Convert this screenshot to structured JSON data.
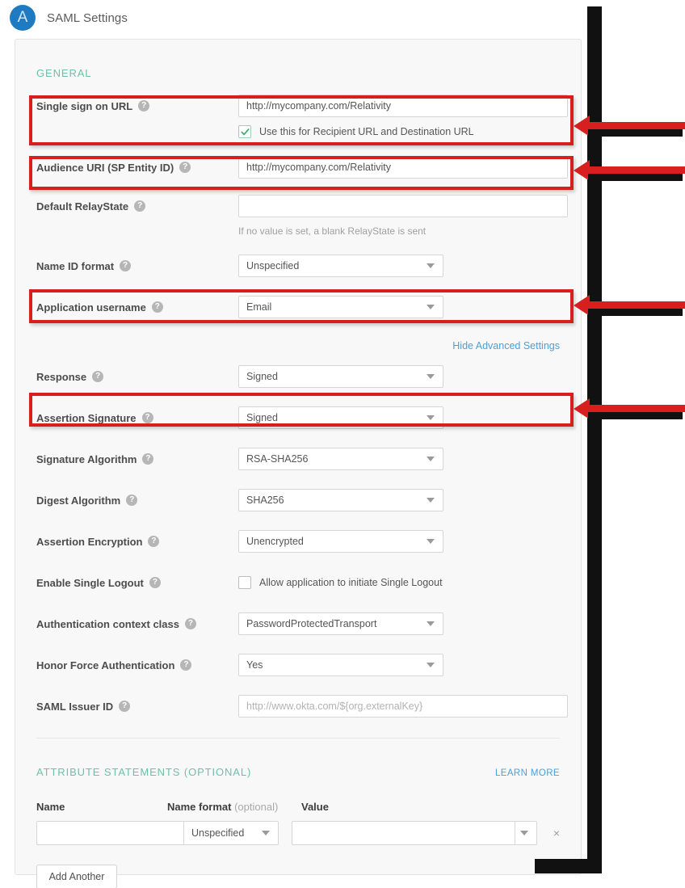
{
  "header": {
    "avatar_letter": "A",
    "title": "SAML Settings"
  },
  "general": {
    "section_label": "GENERAL",
    "fields": {
      "single_sign_on_url": {
        "label": "Single sign on URL",
        "value": "http://mycompany.com/Relativity",
        "checkbox_label": "Use this for Recipient URL and Destination URL",
        "checkbox_checked": true
      },
      "audience_uri": {
        "label": "Audience URI (SP Entity ID)",
        "value": "http://mycompany.com/Relativity"
      },
      "default_relaystate": {
        "label": "Default RelayState",
        "value": "",
        "hint": "If no value is set, a blank RelayState is sent"
      },
      "name_id_format": {
        "label": "Name ID format",
        "value": "Unspecified"
      },
      "application_username": {
        "label": "Application username",
        "value": "Email"
      }
    },
    "advanced_toggle": "Hide Advanced Settings",
    "advanced": {
      "response": {
        "label": "Response",
        "value": "Signed"
      },
      "assertion_signature": {
        "label": "Assertion Signature",
        "value": "Signed"
      },
      "signature_algorithm": {
        "label": "Signature Algorithm",
        "value": "RSA-SHA256"
      },
      "digest_algorithm": {
        "label": "Digest Algorithm",
        "value": "SHA256"
      },
      "assertion_encryption": {
        "label": "Assertion Encryption",
        "value": "Unencrypted"
      },
      "enable_single_logout": {
        "label": "Enable Single Logout",
        "checkbox_label": "Allow application to initiate Single Logout",
        "checkbox_checked": false
      },
      "authentication_context_class": {
        "label": "Authentication context class",
        "value": "PasswordProtectedTransport"
      },
      "honor_force_authentication": {
        "label": "Honor Force Authentication",
        "value": "Yes"
      },
      "saml_issuer_id": {
        "label": "SAML Issuer ID",
        "value": "",
        "placeholder": "http://www.okta.com/${org.externalKey}"
      }
    }
  },
  "attributes": {
    "section_label": "ATTRIBUTE STATEMENTS (OPTIONAL)",
    "learn_more": "LEARN MORE",
    "columns": {
      "name": "Name",
      "name_format": "Name format",
      "name_format_optional": "(optional)",
      "value": "Value"
    },
    "rows": [
      {
        "name": "",
        "name_format": "Unspecified",
        "value": "",
        "remove_icon": "×"
      }
    ],
    "add_another": "Add Another"
  },
  "icons": {
    "help": "?",
    "caret_down": "caret-down",
    "check": "check-mark",
    "close": "×"
  },
  "colors": {
    "accent_blue": "#1f7bc1",
    "link_blue": "#4c9fd8",
    "section_teal": "#6fc0a8",
    "annotation_red": "#d81f1f",
    "check_green": "#3fae6b",
    "card_bg": "#f8f8f8"
  }
}
